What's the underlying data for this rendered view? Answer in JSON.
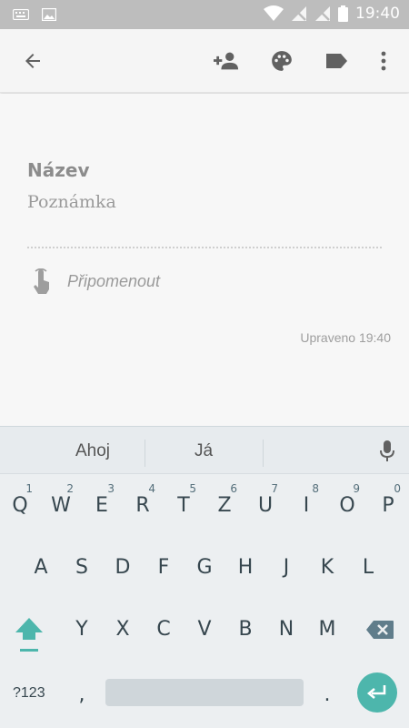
{
  "status_bar": {
    "time": "19:40",
    "icons": [
      "keyboard-icon",
      "image-icon",
      "wifi-icon",
      "no-signal-icon",
      "no-signal-icon",
      "battery-icon"
    ]
  },
  "toolbar": {
    "back_icon": "arrow-left-icon",
    "add_collaborator_icon": "person-add-icon",
    "color_icon": "palette-icon",
    "label_icon": "label-icon",
    "more_icon": "more-vertical-icon"
  },
  "note": {
    "title_placeholder": "Název",
    "body_placeholder": "Poznámka",
    "reminder_label": "Připomenout",
    "edited_text": "Upraveno 19:40"
  },
  "keyboard": {
    "suggestions": [
      "Ahoj",
      "Já"
    ],
    "row1": [
      {
        "key": "Q",
        "num": "1"
      },
      {
        "key": "W",
        "num": "2"
      },
      {
        "key": "E",
        "num": "3"
      },
      {
        "key": "R",
        "num": "4"
      },
      {
        "key": "T",
        "num": "5"
      },
      {
        "key": "Z",
        "num": "6"
      },
      {
        "key": "U",
        "num": "7"
      },
      {
        "key": "I",
        "num": "8"
      },
      {
        "key": "O",
        "num": "9"
      },
      {
        "key": "P",
        "num": "0"
      }
    ],
    "row2": [
      "A",
      "S",
      "D",
      "F",
      "G",
      "H",
      "J",
      "K",
      "L"
    ],
    "row3": [
      "Y",
      "X",
      "C",
      "V",
      "B",
      "N",
      "M"
    ],
    "symbols_label": "?123",
    "comma": ",",
    "period": ".",
    "accent_color": "#4db6ac"
  }
}
